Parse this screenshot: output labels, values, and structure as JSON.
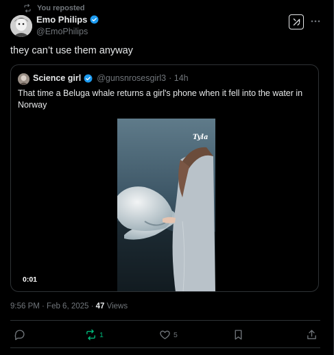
{
  "repost": {
    "label": "You reposted"
  },
  "author": {
    "name": "Emo Philips",
    "handle": "@EmoPhilips"
  },
  "tweet": {
    "text": "they can’t use them anyway"
  },
  "quote": {
    "name": "Science girl",
    "handle": "@gunsnrosesgirl3",
    "time": "· 14h",
    "text": "That time a Beluga whale returns a girl's phone when it fell into the water in Norway",
    "video": {
      "timestamp": "0:01",
      "watermark": "Tyla"
    }
  },
  "meta": {
    "datetime": "9:56 PM · Feb 6, 2025 · ",
    "views_count": "47",
    "views_label": " Views"
  },
  "actions": {
    "reposts": "1",
    "likes": "5"
  },
  "colors": {
    "verified": "#1d9bf0",
    "repost_active": "#00ba7c",
    "muted": "#71767b"
  },
  "icons": [
    "repost-icon",
    "verified-icon",
    "grok-icon",
    "more-icon",
    "reply-icon",
    "like-icon",
    "bookmark-icon",
    "share-icon"
  ]
}
